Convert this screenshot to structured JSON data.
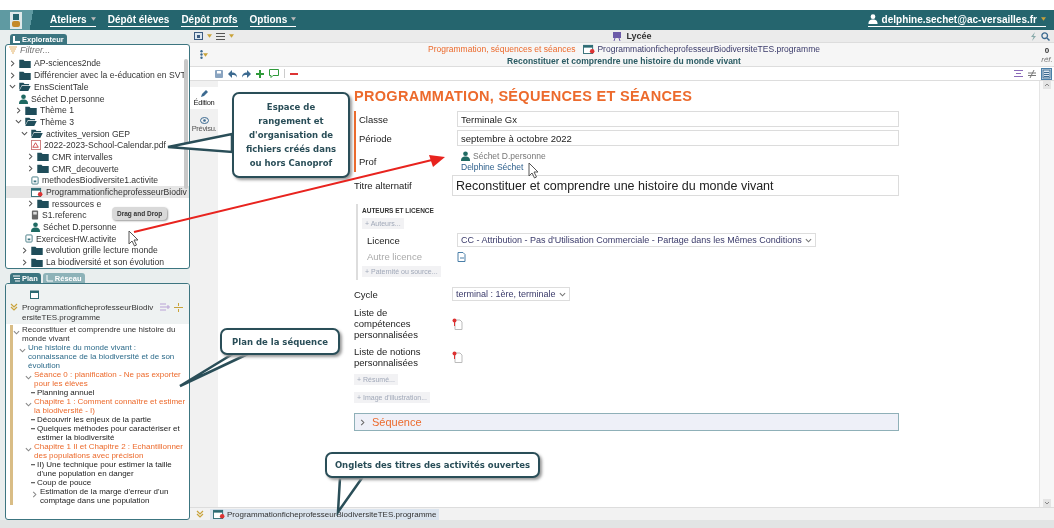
{
  "menu": {
    "items": [
      {
        "label": "Ateliers",
        "has_menu": true
      },
      {
        "label": "Dépôt élèves",
        "has_menu": false
      },
      {
        "label": "Dépôt profs",
        "has_menu": false
      },
      {
        "label": "Options",
        "has_menu": true
      }
    ],
    "user": "delphine.sechet@ac-versailles.fr"
  },
  "explorer": {
    "tab": "Explorateur",
    "filter_placeholder": "Filtrer...",
    "tree": [
      {
        "label": "AP-sciences2nde",
        "kind": "folder",
        "expanded": false,
        "selected": false
      },
      {
        "label": "Différencier avec la e-éducation en SVT",
        "kind": "folder",
        "expanded": false,
        "selected": false
      },
      {
        "label": "EnsScientTale",
        "kind": "folder",
        "expanded": true,
        "selected": false,
        "children": [
          {
            "label": "Séchet D.personne",
            "kind": "person",
            "selected": false
          },
          {
            "label": "Thème 1",
            "kind": "folder",
            "expanded": false,
            "selected": false
          },
          {
            "label": "Thème 3",
            "kind": "folder",
            "expanded": true,
            "selected": false,
            "children": [
              {
                "label": "activites_version GEP",
                "kind": "folder",
                "expanded": true,
                "selected": false,
                "children": [
                  {
                    "label": "2022-2023-School-Calendar.pdf",
                    "kind": "pdf",
                    "selected": false
                  },
                  {
                    "label": "CMR intervalles",
                    "kind": "folder",
                    "expanded": false,
                    "selected": false
                  },
                  {
                    "label": "CMR_decouverte",
                    "kind": "folder",
                    "expanded": false,
                    "selected": false
                  },
                  {
                    "label": "methodesBiodiversite1.activite",
                    "kind": "activity",
                    "selected": false
                  },
                  {
                    "label": "ProgrammationficheprofesseurBiodiv",
                    "kind": "programme",
                    "selected": true
                  },
                  {
                    "label": "ressources e",
                    "kind": "folder",
                    "expanded": false,
                    "selected": false
                  },
                  {
                    "label": "S1.referenc",
                    "kind": "reference",
                    "selected": false
                  },
                  {
                    "label": "Séchet D.personne",
                    "kind": "person",
                    "selected": false
                  }
                ]
              },
              {
                "label": "ExercicesHW.activite",
                "kind": "activity",
                "selected": false
              },
              {
                "label": "evolution grille lecture monde",
                "kind": "folder",
                "expanded": false,
                "selected": false
              },
              {
                "label": "La biodiversité et son évolution",
                "kind": "folder",
                "expanded": false,
                "selected": false
              }
            ]
          }
        ]
      }
    ]
  },
  "plan": {
    "tabs": [
      {
        "label": "Plan",
        "selected": true
      },
      {
        "label": "Réseau",
        "selected": false
      }
    ],
    "file": "ProgrammationficheprofesseurBiodiversiteTES.programme",
    "items": [
      {
        "label": "Reconstituer et comprendre une histoire du monde vivant",
        "kind": "root",
        "expanded": true,
        "children": [
          {
            "label": "Une histoire du monde vivant : connaissance de la biodiversité et de son évolution",
            "kind": "sequence",
            "expanded": true,
            "children": [
              {
                "label": "Séance 0 : planification - Ne pas exporter pour les élèves",
                "kind": "seance",
                "expanded": true,
                "children": [
                  {
                    "label": "Planning annuel",
                    "kind": "activity"
                  }
                ]
              },
              {
                "label": "Chapitre 1 : Comment connaître et estimer la biodiversité - I)",
                "kind": "seance",
                "expanded": true,
                "children": [
                  {
                    "label": "Découvrir les enjeux de la partie",
                    "kind": "activity"
                  },
                  {
                    "label": "Quelques méthodes pour caractériser et estimer la biodiversité",
                    "kind": "activity"
                  }
                ]
              },
              {
                "label": "Chapitre 1 II et Chapitre 2 : Echantillonner des populations avec précision",
                "kind": "seance",
                "expanded": true,
                "children": [
                  {
                    "label": "II) Une technique pour estimer la taille d'une population en danger",
                    "kind": "activity"
                  },
                  {
                    "label": "Coup de pouce",
                    "kind": "activity"
                  },
                  {
                    "label": "Estimation de la marge d'erreur d'un comptage dans une population",
                    "kind": "activity",
                    "expanded": false
                  }
                ]
              }
            ]
          }
        ]
      }
    ]
  },
  "header": {
    "space": "Lycée",
    "model": "Programmation, séquences et séances",
    "file": "ProgrammationficheprofesseurBiodiversiteTES.programme",
    "subtitle": "Reconstituer et comprendre une histoire du monde vivant",
    "ref_count": "0",
    "ref_label": "réf."
  },
  "side_tabs": [
    {
      "label": "Édition",
      "selected": true
    },
    {
      "label": "Prévisu.",
      "selected": false
    }
  ],
  "form": {
    "heading": "PROGRAMMATION, SÉQUENCES ET SÉANCES",
    "fields": [
      {
        "kind": "text",
        "label": "Classe",
        "value": "Terminale Gx"
      },
      {
        "kind": "text",
        "label": "Période",
        "value": "septembre à octobre 2022"
      },
      {
        "kind": "person",
        "label": "Prof",
        "person": "Séchet D.personne",
        "link": "Delphine Séchet"
      }
    ],
    "alt_title": {
      "label": "Titre alternatif",
      "value": "Reconstituer et comprendre une histoire du monde vivant"
    },
    "authors": {
      "heading": "AUTEURS ET LICENCE",
      "add_authors": "+ Auteurs...",
      "licence_label": "Licence",
      "licence": "CC - Attribution - Pas d'Utilisation Commerciale - Partage dans les Mêmes Conditions",
      "other_label": "Autre licence",
      "add_source": "+ Paternité ou source..."
    },
    "extra": [
      {
        "kind": "select",
        "label": "Cycle",
        "value": "terminal : 1ère, terminale"
      },
      {
        "kind": "file",
        "label": "Liste de compétences personnalisées"
      },
      {
        "kind": "file",
        "label": "Liste de notions personnalisées"
      }
    ],
    "add_buttons": [
      "+ Résumé...",
      "+ Image d'illustration..."
    ],
    "section": {
      "label": "Séquence",
      "expanded": false
    }
  },
  "open_tabs": [
    {
      "label": "ProgrammationficheprofesseurBiodiversiteTES.programme",
      "selected": true
    }
  ],
  "callouts": [
    {
      "text": "Espace de rangement et d'organisation de fichiers créés dans ou hors Canoprof"
    },
    {
      "text": "Plan de la séquence"
    },
    {
      "text": "Onglets des titres des activités ouvertes"
    }
  ],
  "tooltip": "Drag and Drop"
}
